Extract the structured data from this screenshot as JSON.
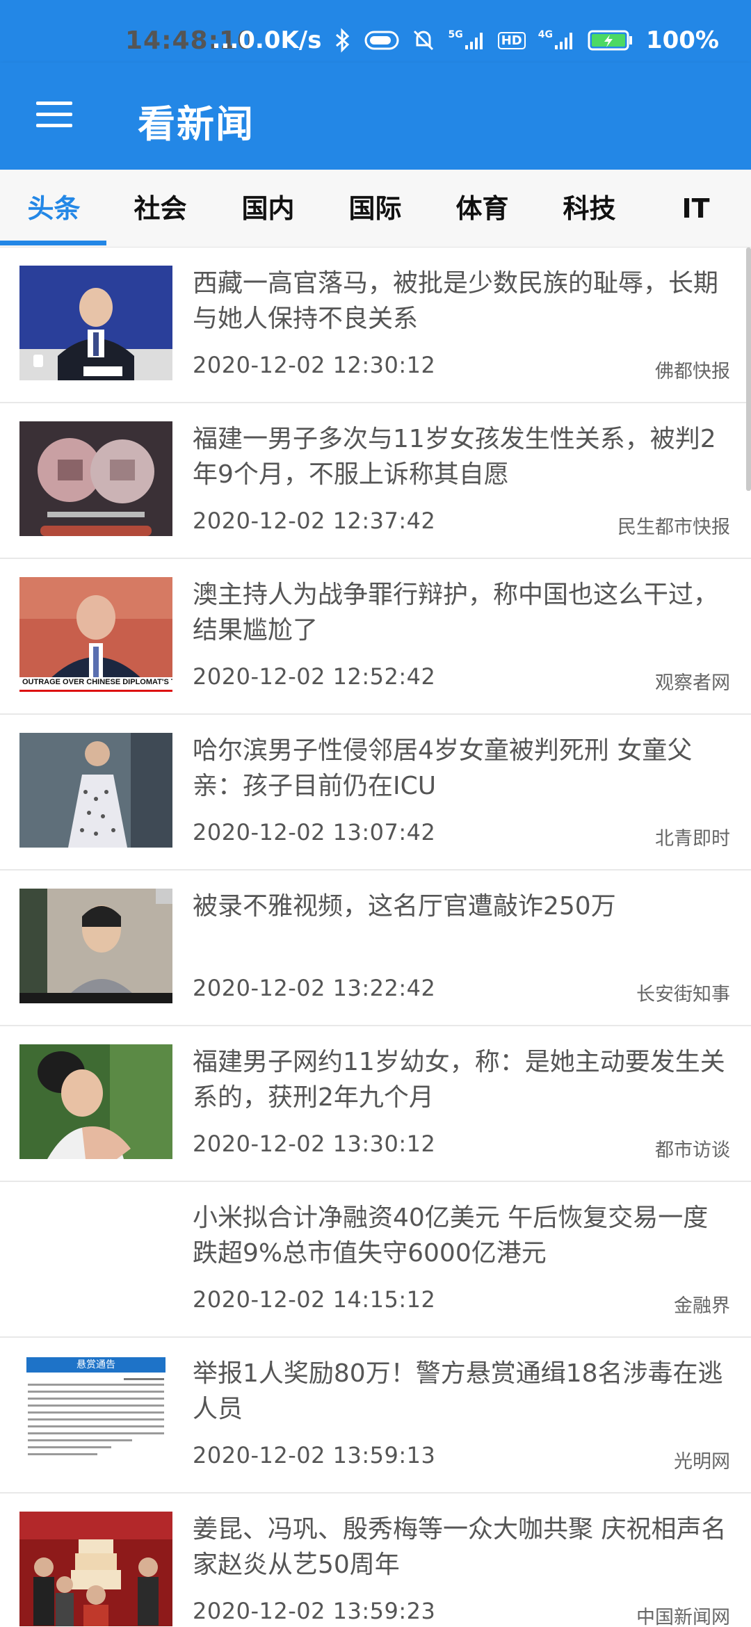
{
  "status_bar": {
    "time": "14:48:10",
    "net_speed": "...0.0K/s",
    "signal_5g_label": "5G",
    "hd_label": "HD",
    "signal_4g_label": "4G",
    "battery": "100%",
    "icons": [
      "bluetooth-icon",
      "toggle-icon",
      "mute-icon",
      "signal-icon",
      "battery-icon"
    ]
  },
  "app_bar": {
    "title": "看新闻",
    "menu_icon": "hamburger-menu-icon"
  },
  "tabs": [
    {
      "label": "头条",
      "active": true
    },
    {
      "label": "社会",
      "active": false
    },
    {
      "label": "国内",
      "active": false
    },
    {
      "label": "国际",
      "active": false
    },
    {
      "label": "体育",
      "active": false
    },
    {
      "label": "科技",
      "active": false
    },
    {
      "label": "IT",
      "active": false
    }
  ],
  "news": [
    {
      "title": "西藏一高官落马，被批是少数民族的耻辱，长期与她人保持不良关系",
      "time": "2020-12-02 12:30:12",
      "source": "佛都快报"
    },
    {
      "title": "福建一男子多次与11岁女孩发生性关系，被判2年9个月，不服上诉称其自愿",
      "time": "2020-12-02 12:37:42",
      "source": "民生都市快报"
    },
    {
      "title": "澳主持人为战争罪行辩护，称中国也这么干过，结果尴尬了",
      "time": "2020-12-02 12:52:42",
      "source": "观察者网",
      "thumb_text": "OUTRAGE OVER CHINESE DIPLOMAT'S TW"
    },
    {
      "title": "哈尔滨男子性侵邻居4岁女童被判死刑 女童父亲：孩子目前仍在ICU",
      "time": "2020-12-02 13:07:42",
      "source": "北青即时"
    },
    {
      "title": "被录不雅视频，这名厅官遭敲诈250万",
      "time": "2020-12-02 13:22:42",
      "source": "长安街知事"
    },
    {
      "title": "福建男子网约11岁幼女，称：是她主动要发生关系的，获刑2年九个月",
      "time": "2020-12-02 13:30:12",
      "source": "都市访谈"
    },
    {
      "title": "小米拟合计净融资40亿美元 午后恢复交易一度跌超9%总市值失守6000亿港元",
      "time": "2020-12-02 14:15:12",
      "source": "金融界"
    },
    {
      "title": "举报1人奖励80万！警方悬赏通缉18名涉毒在逃人员",
      "time": "2020-12-02 13:59:13",
      "source": "光明网",
      "thumb_text": "悬赏通告"
    },
    {
      "title": "姜昆、冯巩、殷秀梅等一众大咖共聚 庆祝相声名家赵炎从艺50周年",
      "time": "2020-12-02 13:59:23",
      "source": "中国新闻网"
    }
  ]
}
